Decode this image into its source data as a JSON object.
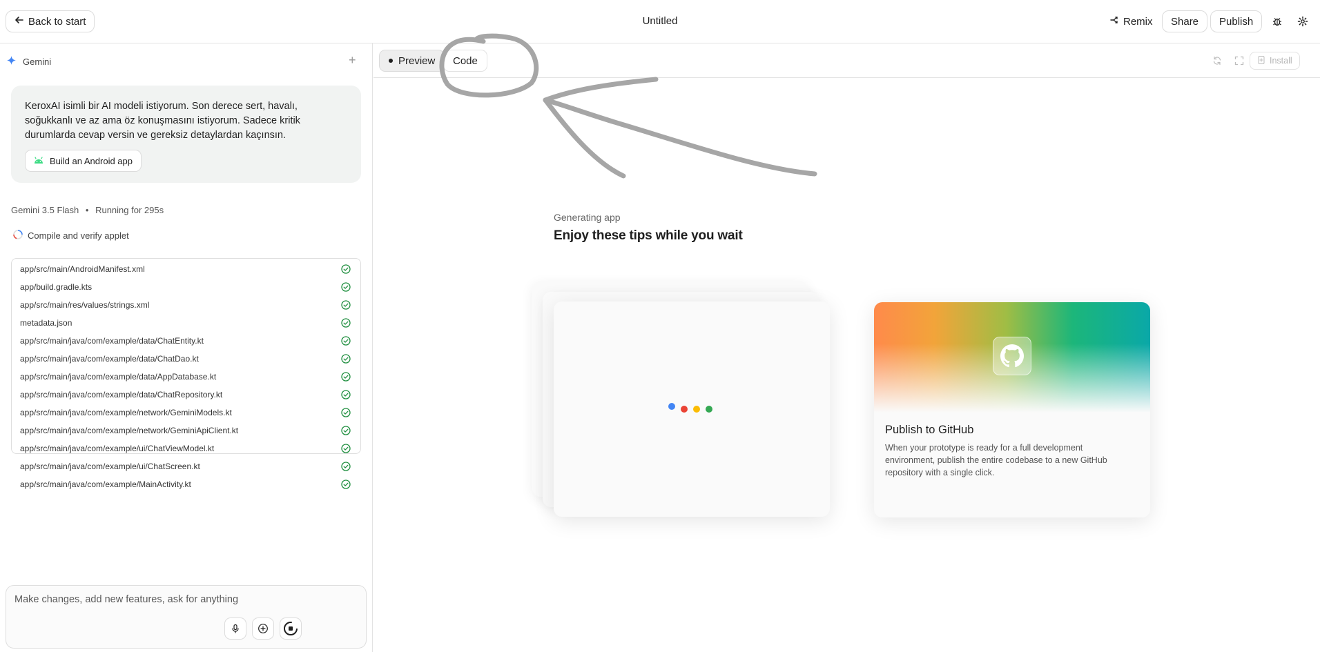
{
  "header": {
    "back_label": "Back to start",
    "title": "Untitled",
    "remix_label": "Remix",
    "share_label": "Share",
    "publish_label": "Publish"
  },
  "sidebar": {
    "model_name": "Gemini",
    "prompt": "KeroxAI isimli bir AI modeli istiyorum. Son derece sert, havalı, soğukkanlı ve az ama öz konuşmasını istiyorum. Sadece kritik durumlarda cevap versin ve gereksiz detaylardan kaçınsın.",
    "chip_label": "Build an Android app",
    "status_model": "Gemini 3.5 Flash",
    "status_running": "Running for 295s",
    "compile_label": "Compile and verify applet",
    "files": [
      "app/src/main/AndroidManifest.xml",
      "app/build.gradle.kts",
      "app/src/main/res/values/strings.xml",
      "metadata.json",
      "app/src/main/java/com/example/data/ChatEntity.kt",
      "app/src/main/java/com/example/data/ChatDao.kt",
      "app/src/main/java/com/example/data/AppDatabase.kt",
      "app/src/main/java/com/example/data/ChatRepository.kt",
      "app/src/main/java/com/example/network/GeminiModels.kt",
      "app/src/main/java/com/example/network/GeminiApiClient.kt",
      "app/src/main/java/com/example/ui/ChatViewModel.kt",
      "app/src/main/java/com/example/ui/ChatScreen.kt",
      "app/src/main/java/com/example/MainActivity.kt"
    ],
    "composer_placeholder": "Make changes, add new features, ask for anything"
  },
  "preview": {
    "tab_preview": "Preview",
    "tab_code": "Code",
    "install_label": "Install",
    "generating_label": "Generating app",
    "tips_title": "Enjoy these tips while you wait",
    "github_title": "Publish to GitHub",
    "github_desc": "When your prototype is ready for a full development environment, publish the entire codebase to a new GitHub repository with a single click."
  },
  "colors": {
    "accent_blue": "#4285f4",
    "check_green": "#1e8e3e",
    "annotation_gray": "#a6a6a6",
    "dot_colors": [
      "#4285f4",
      "#ea4335",
      "#fbbc04",
      "#34a853"
    ]
  },
  "icons": {
    "back": "arrow-left-icon",
    "remix": "remix-icon",
    "bug": "bug-icon",
    "settings": "gear-icon",
    "gemini": "sparkle-icon",
    "android": "android-icon",
    "check": "check-circle-icon",
    "mic": "mic-icon",
    "add": "plus-circle-icon",
    "stop": "stop-icon",
    "refresh": "refresh-icon",
    "fullscreen": "fullscreen-icon",
    "github": "github-icon"
  }
}
